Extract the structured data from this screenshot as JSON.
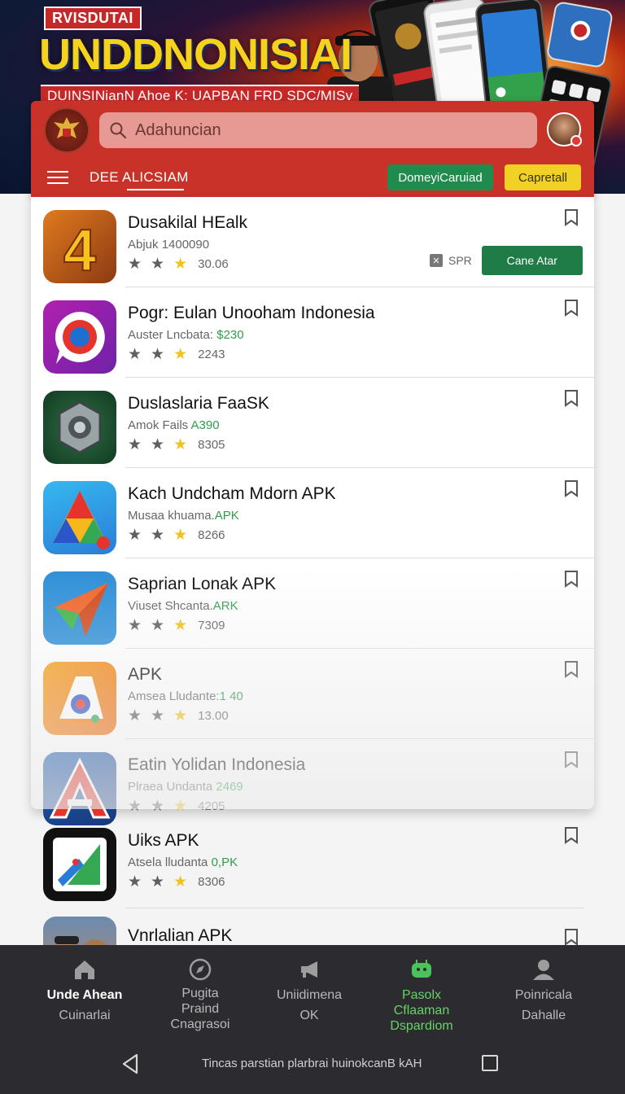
{
  "banner": {
    "tag": "RVISDUTAI",
    "title": "UNDDNONISIAI",
    "subtitle": "DUINSINianN Ahoe K: UAPBAN FRD SDC/MISv"
  },
  "header": {
    "search_placeholder": "Adahuncian",
    "section_title": "DEE ALICSIAM",
    "button_green": "DomeyiCaruiad",
    "button_yellow": "Capretall"
  },
  "apps": [
    {
      "name": "Dusakilal HEalk",
      "sub": "Abjuk 1400090",
      "price": "",
      "rating": "30.06",
      "spr_label": "SPR",
      "action_label": "Cane Atar"
    },
    {
      "name": "Pogr: Eulan Unooham Indonesia",
      "sub": "Auster Lncbata: ",
      "price": "$230",
      "rating": "2243"
    },
    {
      "name": "Duslaslaria FaaSK",
      "sub": "Amok Fails ",
      "price": "A390",
      "rating": "8305"
    },
    {
      "name": "Kach Undcham Mdorn APK",
      "sub": "Musaa khuama.",
      "price": "APK",
      "rating": "8266"
    },
    {
      "name": "Saprian Lonak APK",
      "sub": "Viuset Shcanta.",
      "price": "ARK",
      "rating": "7309"
    },
    {
      "name": "APK",
      "sub": "Amsea Lludante",
      "price": ":1 40",
      "rating": "13.00"
    },
    {
      "name": "Eatin Yolidan Indonesia",
      "sub": "Plraea Undanta ",
      "price": "2469",
      "rating": "4205"
    },
    {
      "name": "Uiks APK",
      "sub": "Atsela lludanta ",
      "price": "0,PK",
      "rating": "8306"
    },
    {
      "name": "Vnrlalian APK"
    }
  ],
  "bottom_nav": [
    {
      "label": "Unde Ahean",
      "label2": "Cuinarlai",
      "icon": "home-icon"
    },
    {
      "label": "Pugita\nPraind",
      "label2": "Cnagrasoi",
      "icon": "compass-icon"
    },
    {
      "label": "Uniidimena",
      "label2": "OK",
      "icon": "megaphone-icon"
    },
    {
      "label": "Pasolx",
      "label2": "Cflaaman\nDspardiom",
      "icon": "android-icon"
    },
    {
      "label": "Poinricala",
      "label2": "Dahalle",
      "icon": "person-icon"
    }
  ],
  "system_bar": {
    "text": "Tincas parstian plarbrai huinokcanB kAH"
  },
  "colors": {
    "header_red": "#c83228",
    "green": "#1f8c4e",
    "yellow": "#f1d125",
    "nav_bg": "#2c2c30"
  }
}
